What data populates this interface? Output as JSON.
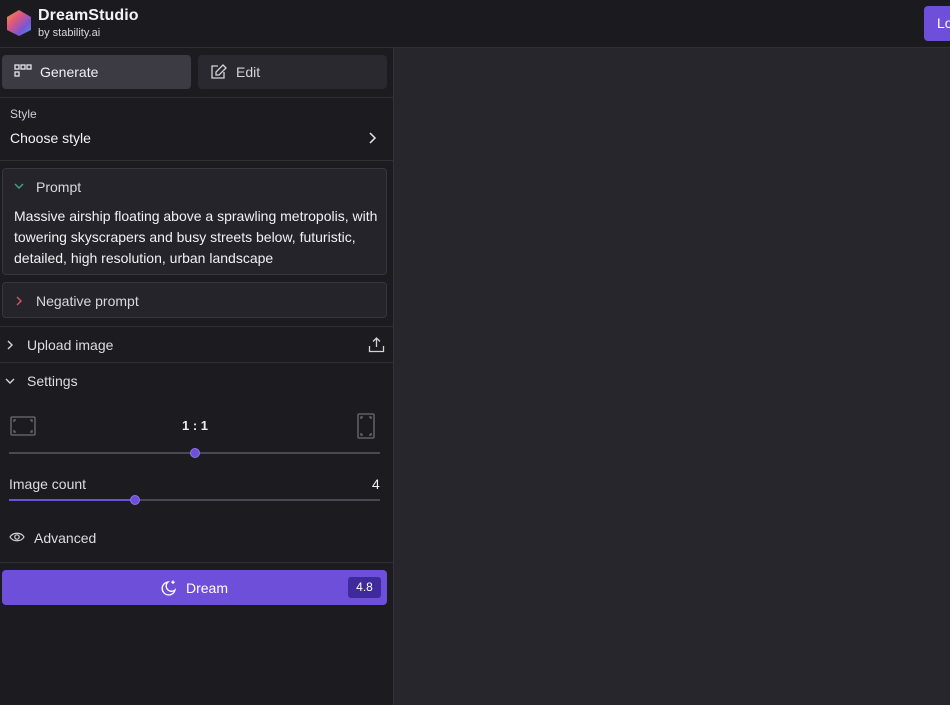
{
  "brand": {
    "name": "DreamStudio",
    "subtitle": "by stability.ai"
  },
  "header": {
    "login_label": "Login"
  },
  "tabs": [
    {
      "label": "Generate",
      "icon": "grid-icon",
      "active": true
    },
    {
      "label": "Edit",
      "icon": "edit-icon",
      "active": false
    }
  ],
  "style": {
    "label": "Style",
    "value": "Choose style"
  },
  "prompt": {
    "title": "Prompt",
    "text": "Massive airship floating above a sprawling metropolis, with towering skyscrapers and busy streets below, futuristic, detailed, high resolution, urban landscape"
  },
  "negative_prompt": {
    "title": "Negative prompt"
  },
  "upload": {
    "label": "Upload image",
    "icon": "upload-icon"
  },
  "settings": {
    "label": "Settings",
    "aspect_ratio": {
      "value": "1 : 1",
      "slider_fraction": 0.5
    },
    "image_count": {
      "label": "Image count",
      "value": "4",
      "slider_fraction": 0.34
    },
    "advanced_label": "Advanced"
  },
  "dream": {
    "label": "Dream",
    "cost": "4.8",
    "icon": "moon-sparkle-icon"
  },
  "colors": {
    "accent": "#6d4fd9",
    "accent_dark": "#3f2a9c",
    "sidebar_bg": "#1c1b20",
    "main_bg": "#28262d"
  }
}
